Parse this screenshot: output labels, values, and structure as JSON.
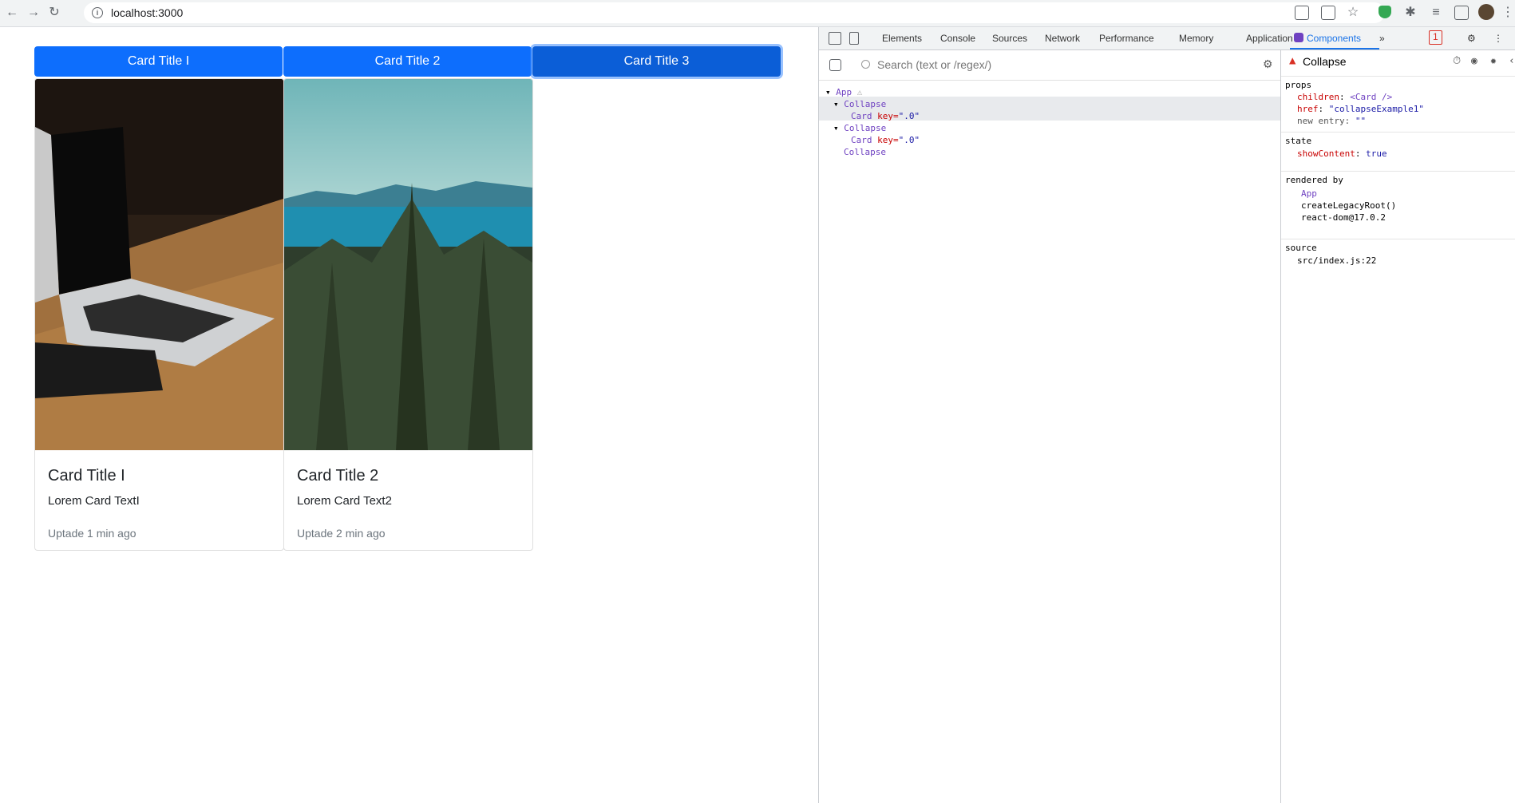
{
  "browser": {
    "url": "localhost:3000"
  },
  "page": {
    "buttons": [
      {
        "label": "Card Title I"
      },
      {
        "label": "Card Title 2"
      },
      {
        "label": "Card Title 3"
      }
    ],
    "cards": [
      {
        "title": "Card Title I",
        "text": "Lorem Card TextI",
        "footer": "Uptade 1 min ago",
        "image": "laptop-desk-photo"
      },
      {
        "title": "Card Title 2",
        "text": "Lorem Card Text2",
        "footer": "Uptade 2 min ago",
        "image": "forest-lake-photo"
      }
    ]
  },
  "devtools": {
    "tabs": [
      "Elements",
      "Console",
      "Sources",
      "Network",
      "Performance",
      "Memory",
      "Application",
      "Components"
    ],
    "selected_tab": "Components",
    "more": "»",
    "error_count": "1",
    "search_placeholder": "Search (text or /regex/)",
    "tree": [
      {
        "name": "App",
        "warn": "⚠"
      },
      {
        "name": "Collapse"
      },
      {
        "name": "Card",
        "key_label": "key=",
        "key_value": "\".0\""
      },
      {
        "name": "Collapse"
      },
      {
        "name": "Card",
        "key_label": "key=",
        "key_value": "\".0\""
      },
      {
        "name": "Collapse"
      }
    ],
    "inspector": {
      "title": "Collapse",
      "props_header": "props",
      "props": [
        {
          "key": "children",
          "value": "<Card />"
        },
        {
          "key": "href",
          "value": "\"collapseExample1\""
        },
        {
          "key": "new entry",
          "value": "\"\""
        }
      ],
      "state_header": "state",
      "state": [
        {
          "key": "showContent",
          "value": "true"
        }
      ],
      "rendered_header": "rendered by",
      "rendered": [
        "App",
        "createLegacyRoot()",
        "react-dom@17.0.2"
      ],
      "source_header": "source",
      "source": "src/index.js:22"
    }
  }
}
